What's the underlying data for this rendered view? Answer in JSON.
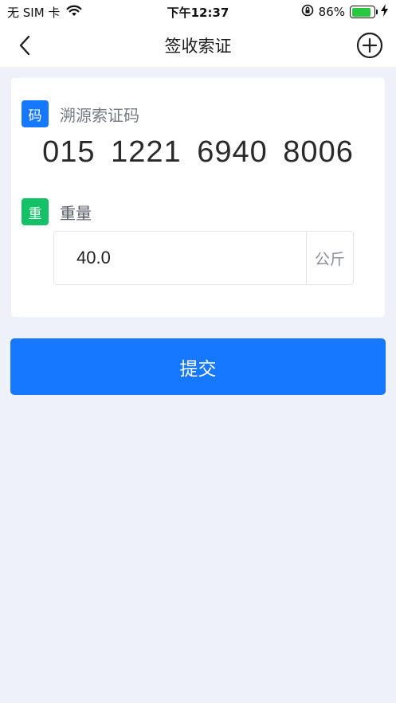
{
  "status_bar": {
    "carrier": "无 SIM 卡",
    "time": "下午12:37",
    "battery": "86%",
    "battery_level": 0.86,
    "battery_color": "#28c940"
  },
  "nav": {
    "title": "签收索证",
    "back_icon": "chevron-left-icon",
    "add_icon": "plus-circle-icon"
  },
  "trace_code": {
    "tag": "码",
    "label": "溯源索证码",
    "value": "015 1221 6940 8006",
    "tag_color": "#1677ff"
  },
  "weight": {
    "tag": "重",
    "label": "重量",
    "value": "40.0",
    "unit": "公斤",
    "tag_color": "#14c167"
  },
  "submit": {
    "label": "提交",
    "color": "#1677ff"
  }
}
